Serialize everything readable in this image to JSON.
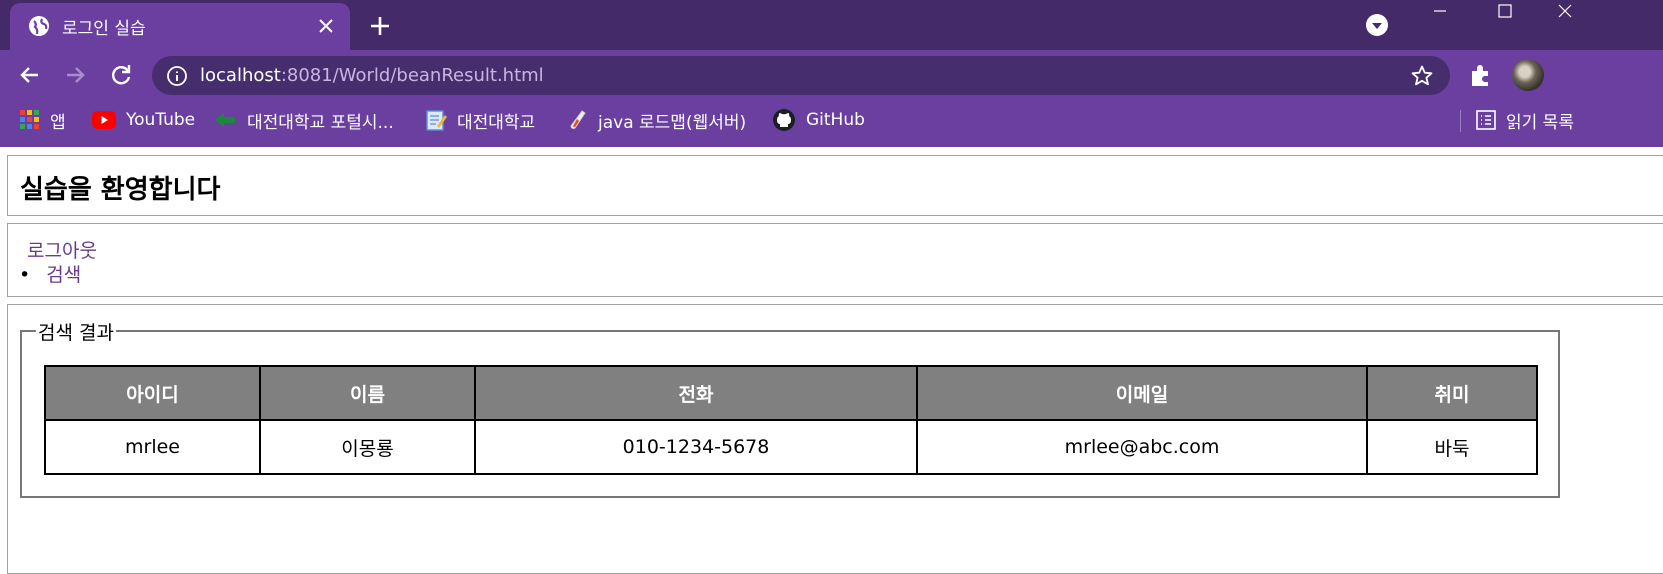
{
  "browser": {
    "tab_title": "로그인 실습",
    "url_host": "localhost",
    "url_rest": ":8081/World/beanResult.html",
    "bookmarks": [
      {
        "label": "앱",
        "icon": "apps-grid-icon"
      },
      {
        "label": "YouTube",
        "icon": "youtube-icon"
      },
      {
        "label": "대전대학교 포털시...",
        "icon": "portal-arrow-icon"
      },
      {
        "label": "대전대학교",
        "icon": "notepad-icon"
      },
      {
        "label": "java 로드맵(웹서버)",
        "icon": "test-tube-icon"
      },
      {
        "label": "GitHub",
        "icon": "github-icon"
      }
    ],
    "reading_list": "읽기 목록",
    "theme_color": "#6a3fa0"
  },
  "page": {
    "title": "실습을 환영합니다",
    "logout": "로그아웃",
    "search_link": "검색",
    "legend": "검색 결과",
    "table": {
      "headers": [
        "아이디",
        "이름",
        "전화",
        "이메일",
        "취미"
      ],
      "rows": [
        [
          "mrlee",
          "이몽룡",
          "010-1234-5678",
          "mrlee@abc.com",
          "바둑"
        ]
      ]
    }
  }
}
